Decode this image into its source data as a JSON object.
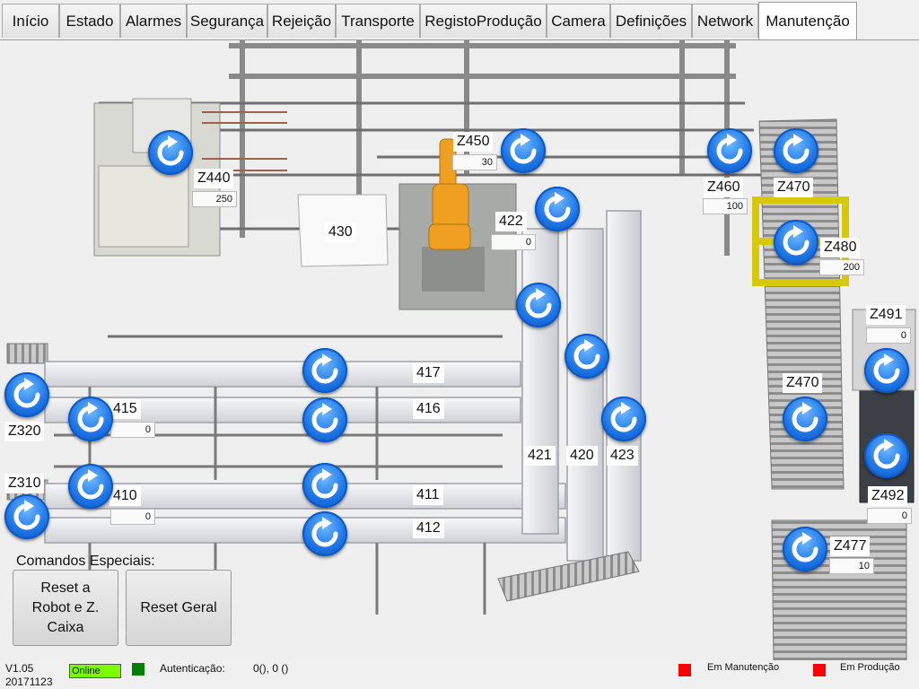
{
  "tabs": [
    "Início",
    "Estado",
    "Alarmes",
    "Segurança",
    "Rejeição",
    "Transporte",
    "RegistoProdução",
    "Camera",
    "Definições",
    "Network",
    "Manutenção"
  ],
  "active_tab": "Manutenção",
  "zones": {
    "z440": {
      "label": "Z440",
      "value": "250"
    },
    "z450": {
      "label": "Z450",
      "value": "30"
    },
    "z460": {
      "label": "Z460",
      "value": "100"
    },
    "z470_top": {
      "label": "Z470"
    },
    "z480": {
      "label": "Z480",
      "value": "200"
    },
    "z491": {
      "label": "Z491",
      "value": "0"
    },
    "z470_mid": {
      "label": "Z470"
    },
    "z492": {
      "label": "Z492",
      "value": "0"
    },
    "z477": {
      "label": "Z477",
      "value": "10"
    },
    "z320": {
      "label": "Z320"
    },
    "z310": {
      "label": "Z310"
    },
    "c422": {
      "label": "422",
      "value": "0"
    },
    "c415": {
      "label": "415",
      "value": "0"
    },
    "c410": {
      "label": "410",
      "value": "0"
    }
  },
  "conveyor_labels": {
    "c430": "430",
    "c417": "417",
    "c416": "416",
    "c411": "411",
    "c412": "412",
    "c421": "421",
    "c420": "420",
    "c423": "423"
  },
  "commands": {
    "title": "Comandos Especiais:",
    "reset_robot": "Reset a Robot e Z. Caixa",
    "reset_geral": "Reset Geral"
  },
  "status": {
    "version": "V1.05",
    "build": "20171123",
    "online": "Online",
    "auth_label": "Autenticação:",
    "auth_value": "0(), 0 ()",
    "maintenance": "Em Manutenção",
    "production": "Em Produção"
  },
  "colors": {
    "online": "#7cfc00",
    "auth_ok": "#008000",
    "indicator_red": "#ff0000",
    "reset_button": "#1f77e8"
  }
}
